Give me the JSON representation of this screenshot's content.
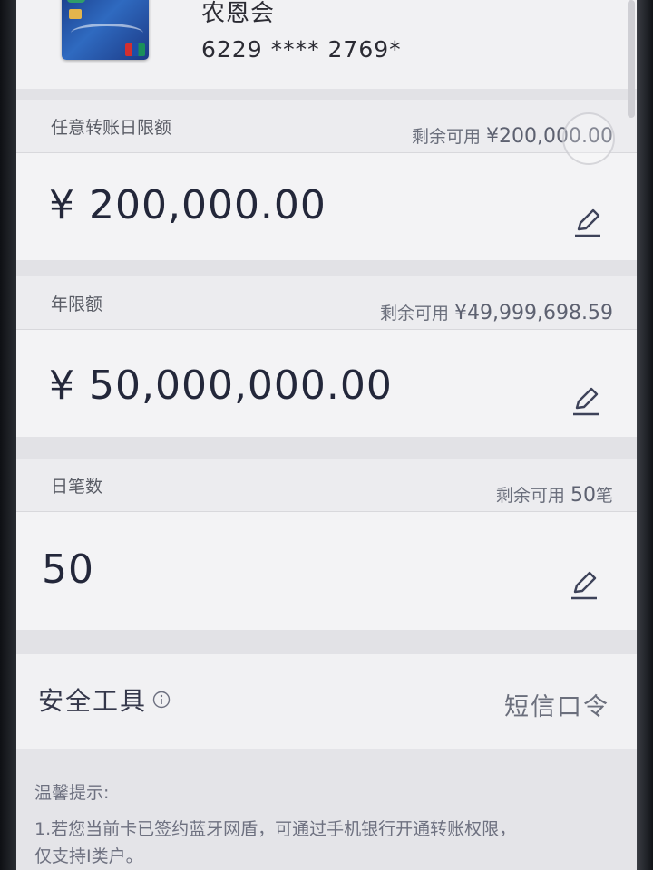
{
  "card": {
    "name": "农恩会",
    "number": "6229 **** 2769*",
    "image_icon": "bank-card-image"
  },
  "daily_transfer_limit": {
    "label": "任意转账日限额",
    "remaining_prefix": "剩余可用",
    "remaining_value": "¥200,000.00",
    "amount": "¥ 200,000.00",
    "edit_icon": "pencil-icon"
  },
  "annual_limit": {
    "label": "年限额",
    "remaining_prefix": "剩余可用",
    "remaining_value": "¥49,999,698.59",
    "amount": "¥ 50,000,000.00",
    "edit_icon": "pencil-icon"
  },
  "daily_count": {
    "label": "日笔数",
    "remaining_prefix": "剩余可用",
    "remaining_value": "50",
    "remaining_suffix": "笔",
    "amount": "50",
    "edit_icon": "pencil-icon"
  },
  "security_tool": {
    "label": "安全工具",
    "info_icon": "info-icon",
    "value": "短信口令"
  },
  "tips": {
    "title": "温馨提示:",
    "line1": "1.若您当前卡已签约蓝牙网盾，可通过手机银行开通转账权限，",
    "line2": "仅支持I类户。"
  },
  "colors": {
    "text_dark": "#23273a",
    "text_muted": "#6b6f7c",
    "background": "#e9e9ec",
    "card_blue": "#1b3f8c"
  }
}
